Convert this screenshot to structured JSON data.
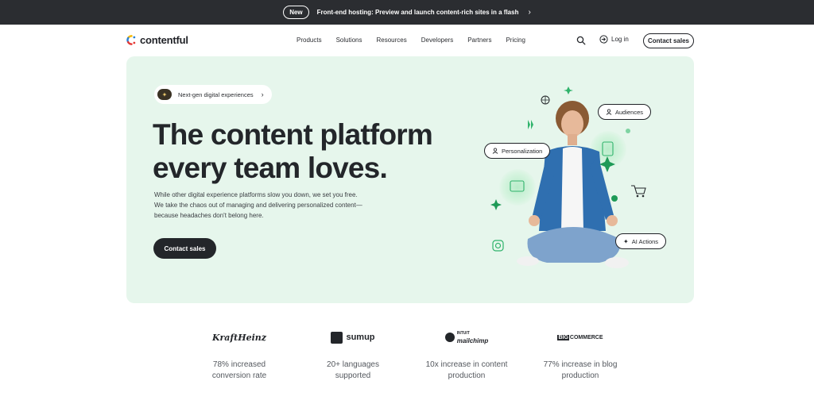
{
  "announcement": {
    "badge": "New",
    "text": "Front-end hosting: Preview and launch content-rich sites in a flash"
  },
  "nav": {
    "logo": "contentful",
    "menu": [
      "Products",
      "Solutions",
      "Resources",
      "Developers",
      "Partners",
      "Pricing"
    ],
    "login": "Log in",
    "contact": "Contact sales"
  },
  "hero": {
    "pill": "Next-gen digital experiences",
    "heading_line1": "The content platform",
    "heading_line2": "every team loves.",
    "sub_line1": "While other digital experience platforms slow you down, we set you free.",
    "sub_line2": "We take the chaos out of managing and delivering personalized content—",
    "sub_line3": "because headaches don't belong here.",
    "cta": "Contact sales",
    "chips": {
      "audiences": "Audiences",
      "personalization": "Personalization",
      "ai": "AI Actions"
    },
    "colors": {
      "bg": "#e6f6ec",
      "accent_green": "#2fb36b"
    }
  },
  "brands": [
    {
      "name": "KraftHeinz",
      "stat_line1": "78% increased",
      "stat_line2": "conversion rate"
    },
    {
      "name": "sumup",
      "stat_line1": "20+ languages",
      "stat_line2": "supported"
    },
    {
      "name_top": "INTUIT",
      "name": "mailchimp",
      "stat_line1": "10x increase in content",
      "stat_line2": "production"
    },
    {
      "name_prefix": "BIG",
      "name": "COMMERCE",
      "stat_line1": "77% increase in blog",
      "stat_line2": "production"
    }
  ]
}
